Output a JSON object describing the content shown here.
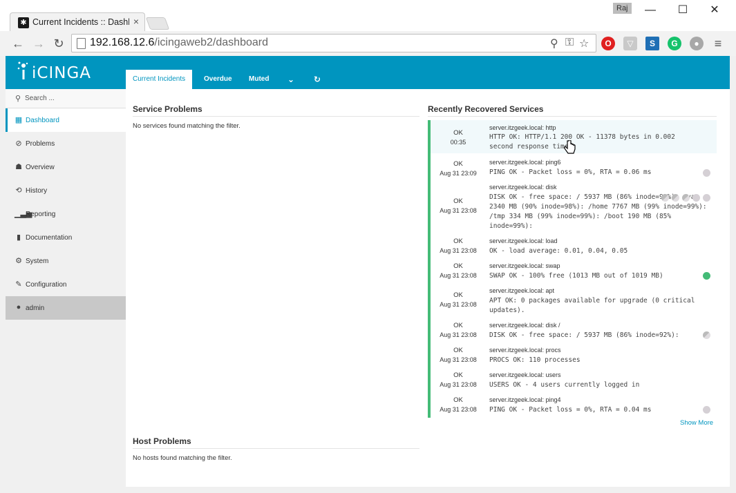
{
  "browser": {
    "tab_title": "Current Incidents :: Dashb",
    "user_chip": "Raj",
    "url_host": "192.168.12.6",
    "url_path": "/icingaweb2/dashboard"
  },
  "app": {
    "logo_text": "iCINGA",
    "tabs": [
      "Current Incidents",
      "Overdue",
      "Muted"
    ],
    "search_placeholder": "Search ...",
    "nav": [
      {
        "label": "Dashboard",
        "icon": "grid-icon"
      },
      {
        "label": "Problems",
        "icon": "problems-icon"
      },
      {
        "label": "Overview",
        "icon": "sitemap-icon"
      },
      {
        "label": "History",
        "icon": "history-icon"
      },
      {
        "label": "Reporting",
        "icon": "bar-chart-icon"
      },
      {
        "label": "Documentation",
        "icon": "book-icon"
      },
      {
        "label": "System",
        "icon": "cogs-icon"
      },
      {
        "label": "Configuration",
        "icon": "wrench-icon"
      },
      {
        "label": "admin",
        "icon": "user-icon"
      }
    ]
  },
  "service_problems": {
    "title": "Service Problems",
    "empty": "No services found matching the filter."
  },
  "host_problems": {
    "title": "Host Problems",
    "empty": "No hosts found matching the filter."
  },
  "recovered": {
    "title": "Recently Recovered Services",
    "show_more": "Show More",
    "rows": [
      {
        "state": "OK",
        "time": "00:35",
        "service": "server.itzgeek.local: http",
        "output": "HTTP OK: HTTP/1.1 200 OK - 11378 bytes in 0.002 second response time"
      },
      {
        "state": "OK",
        "time": "Aug 31 23:09",
        "service": "server.itzgeek.local: ping6",
        "output": "PING OK - Packet loss = 0%, RTA = 0.06 ms"
      },
      {
        "state": "OK",
        "time": "Aug 31 23:08",
        "service": "server.itzgeek.local: disk",
        "output": "DISK OK - free space: / 5937 MB (86% inode=92%): /var 2340 MB (90% inode=98%): /home 7767 MB (99% inode=99%): /tmp 334 MB (99% inode=99%): /boot 190 MB (85% inode=99%):"
      },
      {
        "state": "OK",
        "time": "Aug 31 23:08",
        "service": "server.itzgeek.local: load",
        "output": "OK - load average: 0.01, 0.04, 0.05"
      },
      {
        "state": "OK",
        "time": "Aug 31 23:08",
        "service": "server.itzgeek.local: swap",
        "output": "SWAP OK - 100% free (1013 MB out of 1019 MB)"
      },
      {
        "state": "OK",
        "time": "Aug 31 23:08",
        "service": "server.itzgeek.local: apt",
        "output": "APT OK: 0 packages available for upgrade (0 critical updates)."
      },
      {
        "state": "OK",
        "time": "Aug 31 23:08",
        "service": "server.itzgeek.local: disk /",
        "output": "DISK OK - free space: / 5937 MB (86% inode=92%):"
      },
      {
        "state": "OK",
        "time": "Aug 31 23:08",
        "service": "server.itzgeek.local: procs",
        "output": "PROCS OK: 110 processes"
      },
      {
        "state": "OK",
        "time": "Aug 31 23:08",
        "service": "server.itzgeek.local: users",
        "output": "USERS OK - 4 users currently logged in"
      },
      {
        "state": "OK",
        "time": "Aug 31 23:08",
        "service": "server.itzgeek.local: ping4",
        "output": "PING OK - Packet loss = 0%, RTA = 0.04 ms"
      }
    ]
  },
  "colors": {
    "brand": "#0095bf",
    "ok": "#44bb77"
  }
}
